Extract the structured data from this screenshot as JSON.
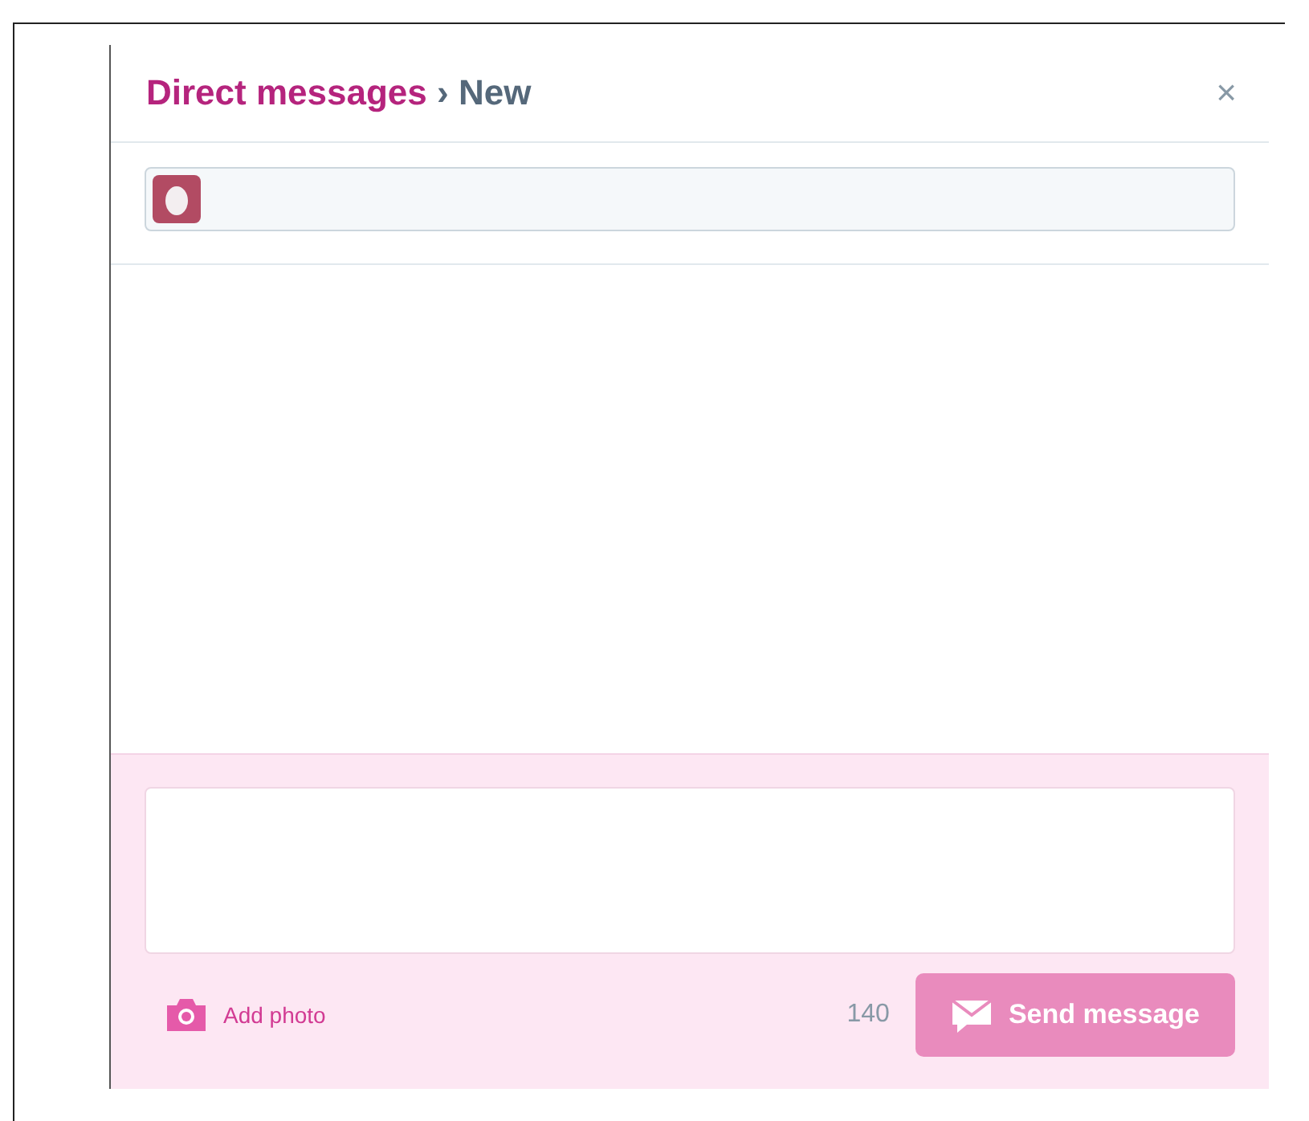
{
  "dialog": {
    "breadcrumb": {
      "parent": "Direct messages",
      "separator": "›",
      "current": "New"
    },
    "close": "×"
  },
  "composer": {
    "add_photo": "Add photo",
    "counter": "140",
    "send": {
      "label": "Send message",
      "disabled": true
    }
  }
}
